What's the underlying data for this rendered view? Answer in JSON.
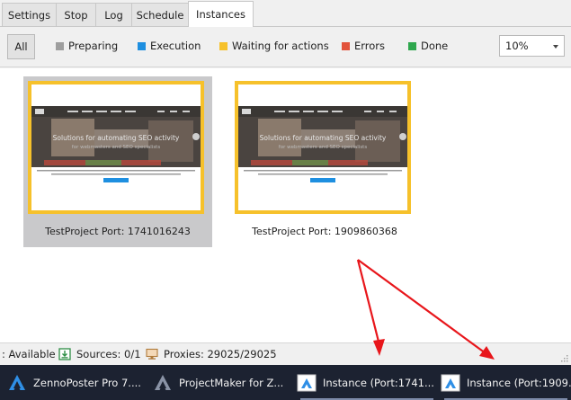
{
  "tabs": [
    {
      "label": "Settings",
      "active": false
    },
    {
      "label": "Stop",
      "active": false
    },
    {
      "label": "Log",
      "active": false
    },
    {
      "label": "Schedule",
      "active": false
    },
    {
      "label": "Instances",
      "active": true
    }
  ],
  "filters": {
    "all_label": "All",
    "legend": [
      {
        "label": "Preparing",
        "color": "#9e9e9e"
      },
      {
        "label": "Execution",
        "color": "#1e8fe0"
      },
      {
        "label": "Waiting for actions",
        "color": "#f6c12b"
      },
      {
        "label": "Errors",
        "color": "#e2533c"
      },
      {
        "label": "Done",
        "color": "#2fa74e"
      }
    ],
    "zoom_value": "10%"
  },
  "instances": [
    {
      "caption": "TestProject Port: 1741016243",
      "selected": true,
      "status_color": "#f6c12b"
    },
    {
      "caption": "TestProject Port: 1909860368",
      "selected": false,
      "status_color": "#f6c12b"
    }
  ],
  "thumbnail": {
    "headline": "Solutions for automating SEO activity",
    "subline": "for webmasters and SEO specialists"
  },
  "statusbar": {
    "available": ": Available",
    "sources": "Sources: 0/1",
    "proxies": "Proxies: 29025/29025"
  },
  "taskbar": [
    {
      "label": "ZennoPoster Pro 7....",
      "icon": "zenno-logo-icon"
    },
    {
      "label": "ProjectMaker for Z...",
      "icon": "projectmaker-logo-icon"
    },
    {
      "label": "Instance (Port:1741...",
      "icon": "instance-window-icon"
    },
    {
      "label": "Instance (Port:1909...",
      "icon": "instance-window-icon"
    }
  ]
}
